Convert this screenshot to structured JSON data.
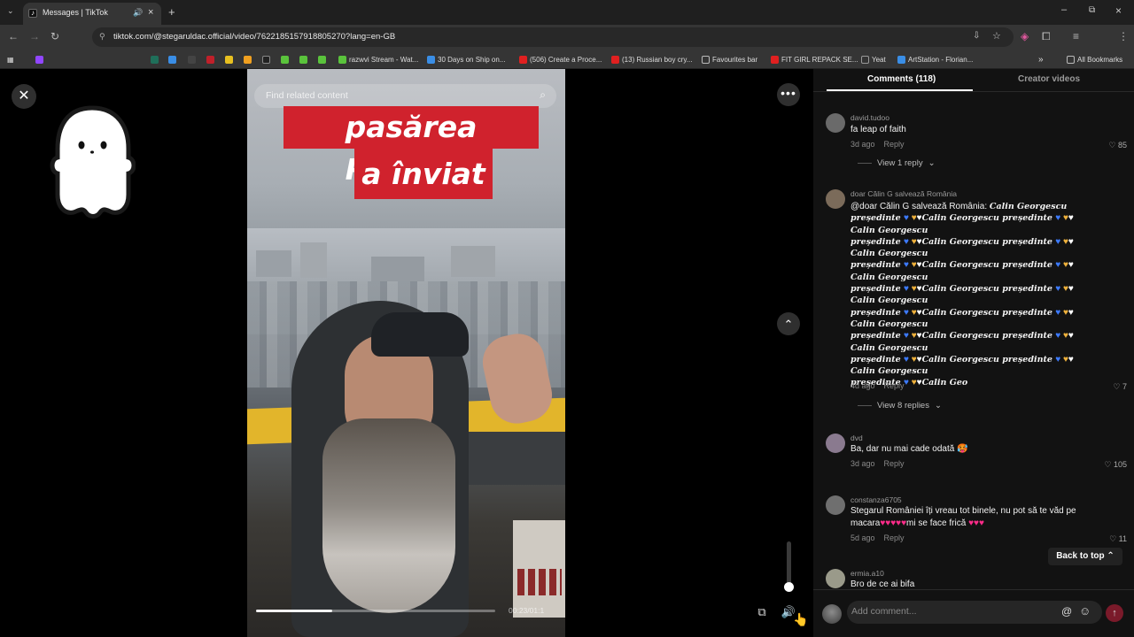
{
  "browser": {
    "tab_title": "Messages | TikTok",
    "tab_favicon_letter": "♪",
    "url": "tiktok.com/@stegaruldac.official/video/7622185157918805270?lang=en-GB",
    "bookmarks": [
      {
        "label": "razwvi Stream - Wat...",
        "color": "#5ac33c"
      },
      {
        "label": "30 Days on Ship on...",
        "color": "#3a8ee6"
      },
      {
        "label": "(506) Create a Proce...",
        "color": "#e02020"
      },
      {
        "label": "(13) Russian boy cry...",
        "color": "#e02020"
      },
      {
        "label": "Favourites bar",
        "color": "#bbbbbb"
      },
      {
        "label": "FIT GIRL REPACK SE...",
        "color": "#e02020"
      },
      {
        "label": "Yeat",
        "color": "#333333"
      },
      {
        "label": "ArtStation - Florian...",
        "color": "#3a8ee6"
      }
    ],
    "all_bookmarks": "All Bookmarks"
  },
  "viewer": {
    "search_placeholder": "Find related content",
    "caption_line1": "pasărea Phoenix",
    "caption_line2": "a înviat",
    "timecode": "00:23/01:1",
    "progress": 0.32,
    "volume_level": 0.15
  },
  "comments_panel": {
    "tab_comments": "Comments (118)",
    "tab_creator": "Creator videos",
    "reply_label": "Reply",
    "back_to_top": "Back to top",
    "add_comment_placeholder": "Add comment...",
    "comments": [
      {
        "user": "david.tudoo",
        "text": "fa leap of faith",
        "time": "3d ago",
        "likes": "85",
        "replies": "View 1 reply",
        "avatar": "#6a6a6a"
      },
      {
        "user": "doar Călin G salvează România",
        "prefix": "@doar Călin G salvează România: ",
        "time": "4d ago",
        "likes": "7",
        "replies": "View 8 replies",
        "avatar": "#7b6b5a"
      },
      {
        "user": "dvd",
        "text": "Ba, dar nu mai cade odată 🥵",
        "time": "3d ago",
        "likes": "105",
        "avatar": "#8a7a8f"
      },
      {
        "user": "constanza6705",
        "text_line1": "Stegarul României îți vreau tot binele, nu pot să te văd pe",
        "text_line2": "macara",
        "text_line2b": "mi se face frică",
        "time": "5d ago",
        "likes": "11",
        "avatar": "#6f6f6f"
      },
      {
        "user": "ermia.a10",
        "text": "Bro de ce ai bifa",
        "avatar": "#9a9a8a"
      }
    ],
    "spam_lines": [
      {
        "pre": "",
        "name": "Calin Georgescu",
        "tail": "",
        "end": "",
        "first": true
      },
      {
        "pre": "președinte",
        "hearts": true,
        "name": "Calin Georgescu",
        "tail": "președinte",
        "end": "hearts"
      },
      {
        "pre": "",
        "name": "Calin Georgescu",
        "tail": "",
        "first": false
      },
      {
        "pre": "președinte",
        "hearts": true,
        "name": "Calin Georgescu",
        "tail": "președinte",
        "end": "hearts"
      },
      {
        "pre": "",
        "name": "Calin Georgescu",
        "tail": ""
      },
      {
        "pre": "președinte",
        "hearts": true,
        "name": "Calin Georgescu",
        "tail": "președinte",
        "end": "hearts"
      },
      {
        "pre": "",
        "name": "Calin Georgescu",
        "tail": ""
      },
      {
        "pre": "președinte",
        "hearts": true,
        "name": "Calin Georgescu",
        "tail": "președinte",
        "end": "hearts"
      },
      {
        "pre": "",
        "name": "Calin Georgescu",
        "tail": ""
      },
      {
        "pre": "președinte",
        "hearts": true,
        "name": "Calin Georgescu",
        "tail": "președinte",
        "end": "hearts"
      },
      {
        "pre": "",
        "name": "Calin Georgescu",
        "tail": ""
      },
      {
        "pre": "președinte",
        "hearts": true,
        "name": "Calin Georgescu",
        "tail": "președinte",
        "end": "hearts"
      },
      {
        "pre": "",
        "name": "Calin Georgescu",
        "tail": ""
      },
      {
        "pre": "președinte",
        "hearts": true,
        "name": "Calin Georgescu",
        "tail": "președinte",
        "end": "hearts"
      },
      {
        "pre": "",
        "name": "Calin Georgescu",
        "tail": ""
      },
      {
        "pre": "președinte",
        "hearts": true,
        "name": "Calin Geo",
        "tail": "",
        "end": ""
      }
    ]
  }
}
